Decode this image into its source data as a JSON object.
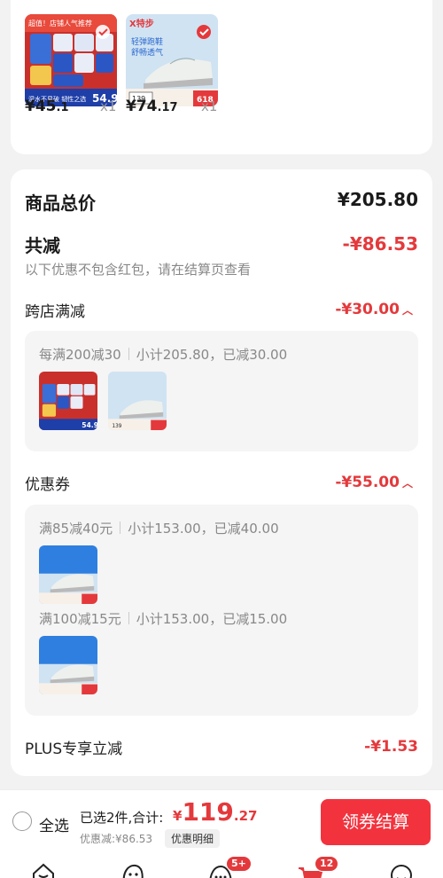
{
  "top_items": [
    {
      "name": "paper-product",
      "price_int": "¥45",
      "price_dec": ".1",
      "qty": "x1"
    },
    {
      "name": "sneaker-product",
      "price_int": "¥74",
      "price_dec": ".17",
      "qty": "x1"
    }
  ],
  "summary": {
    "total_label": "商品总价",
    "total_value": "¥205.80",
    "reduce_label": "共减",
    "reduce_value": "-¥86.53",
    "note": "以下优惠不包含红包，请在结算页查看"
  },
  "cross_store": {
    "label": "跨店满减",
    "amount": "-¥30.00",
    "rule_a": "每满200减30",
    "rule_b": "小计205.80，已减30.00"
  },
  "coupon": {
    "label": "优惠券",
    "amount": "-¥55.00",
    "rule1_a": "满85减40元",
    "rule1_b": "小计153.00，已减40.00",
    "rule2_a": "满100减15元",
    "rule2_b": "小计153.00，已减15.00"
  },
  "plus": {
    "label": "PLUS专享立减",
    "amount": "-¥1.53"
  },
  "bottom_bar": {
    "select_all": "全选",
    "selected": "已选2件,合计:",
    "currency": "¥",
    "total_int": "119",
    "total_dec": ".27",
    "discount": "优惠减:¥86.53",
    "detail": "优惠明细",
    "checkout": "领券结算"
  },
  "tabbar": {
    "messages_badge": "5+",
    "cart_badge": "12"
  },
  "thumb_text": {
    "paper_tag": "超值！店铺人气推荐",
    "paper_slogan": "湿水不易破 韧性之选",
    "paper_price": "54.9",
    "shoe_brand": "X特步",
    "shoe_slogan_1": "轻弹跑鞋",
    "shoe_slogan_2": "舒畅透气",
    "shoe_price": "139",
    "shoe_event": "618"
  },
  "colors": {
    "accent": "#e4393c",
    "checkout_bg": "#f2333e"
  }
}
